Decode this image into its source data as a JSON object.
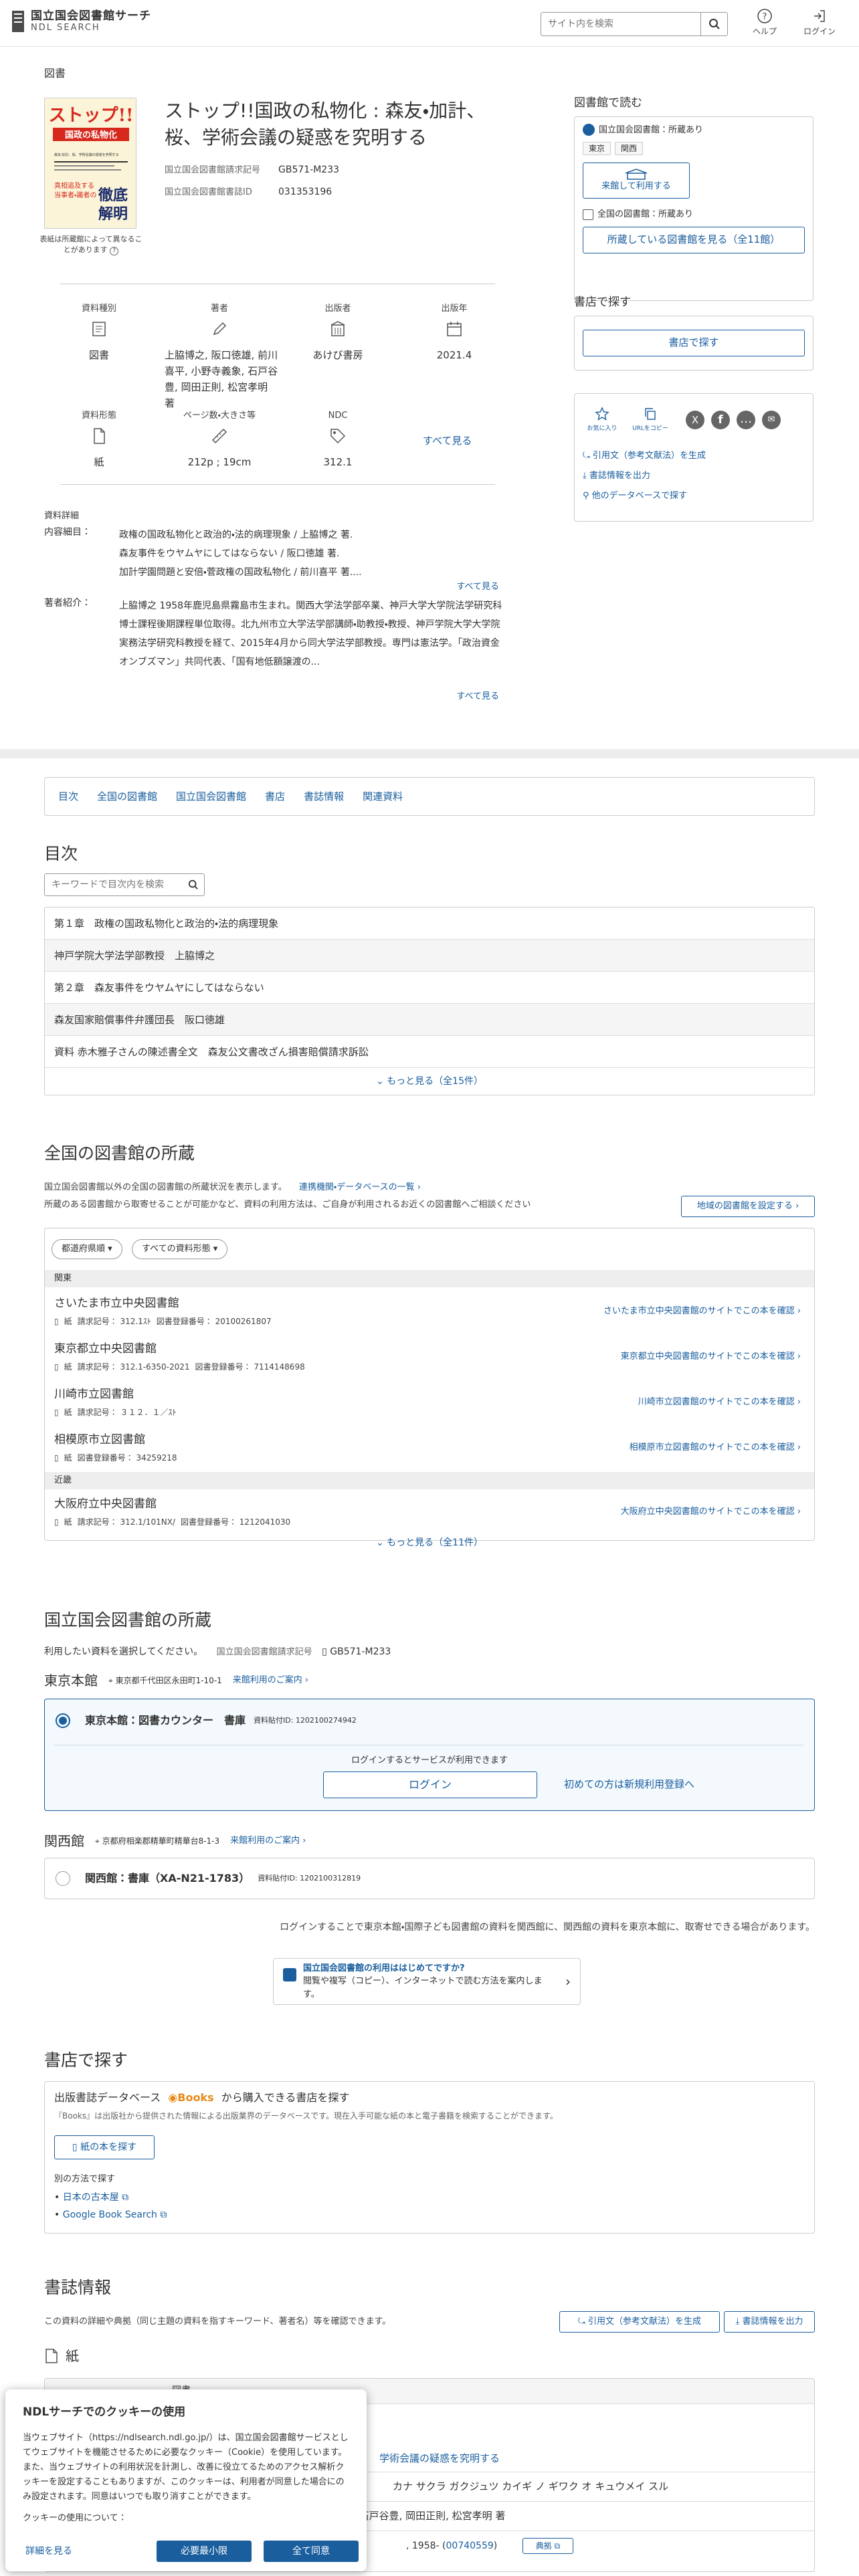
{
  "header": {
    "logo_title": "国立国会図書館サーチ",
    "logo_sub": "NDL SEARCH",
    "search_placeholder": "サイト内を検索",
    "help": "ヘルプ",
    "login": "ログイン"
  },
  "book": {
    "category": "図書",
    "title": "ストップ!!国政の私物化 : 森友・加計、桜、学術会議の疑惑を究明する",
    "cover_note": "表紙は所蔵館によって異なることがあります",
    "call_label": "国立国会図書館請求記号",
    "call_value": "GB571-M233",
    "bib_label": "国立国会図書館書誌ID",
    "bib_value": "031353196",
    "cover_texts": [
      "ストップ!!",
      "国政の私物化",
      "森友・加計、桜、学術会議の疑惑を究明する",
      "真相追及する",
      "当事者・識者の",
      "徹底",
      "解明"
    ],
    "grid": [
      {
        "label": "資料種別",
        "value": "図書",
        "icon": "book-icon"
      },
      {
        "label": "著者",
        "value": "上脇博之, 阪口徳雄, 前川喜平, 小野寺義象, 石戸谷豊, 岡田正則, 松宮孝明 著",
        "icon": "pen-icon"
      },
      {
        "label": "出版者",
        "value": "あけび書房",
        "icon": "building-icon"
      },
      {
        "label": "出版年",
        "value": "2021.4",
        "icon": "calendar-icon"
      },
      {
        "label": "資料形態",
        "value": "紙",
        "icon": "paper-icon"
      },
      {
        "label": "ページ数・大きさ等",
        "value": "212p ; 19cm",
        "icon": "ruler-icon"
      },
      {
        "label": "NDC",
        "value": "312.1",
        "icon": "tag-icon"
      }
    ],
    "see_all": "すべて見る",
    "detail_head": "資料詳細",
    "contents_key": "内容細目：",
    "contents": [
      "政権の国政私物化と政治的・法的病理現象 / 上脇博之 著.",
      "森友事件をウヤムヤにしてはならない / 阪口徳雄 著.",
      "加計学園問題と安倍・菅政権の国政私物化 / 前川喜平 著...."
    ],
    "author_key": "著者紹介：",
    "author_text": "上脇博之 1958年鹿児島県霧島市生まれ。関西大学法学部卒業、神戸大学大学院法学研究科博士課程後期課程単位取得。北九州市立大学法学部講師・助教授・教授、神戸学院大学大学院実務法学研究科教授を経て、2015年4月から同大学法学部教授。専門は憲法学。「政治資金オンブズマン」共同代表、「国有地低額譲渡の...",
    "see_all2": "すべて見る",
    "see_all3": "すべて見る"
  },
  "right": {
    "read_title": "図書館で読む",
    "ndl_holding": "国立国会図書館：所蔵あり",
    "chip1": "東京",
    "chip2": "関西",
    "visit_btn1": "来館して利用する",
    "all_holding": "全国の図書館：所蔵あり",
    "all_btn": "所蔵している図書館を見る（全11館）",
    "shop_title": "書店で探す",
    "shop_btn": "書店で探す",
    "fav": "お気に入り",
    "url": "URLをコピー",
    "cite": "引用文（参考文献法）を生成",
    "export": "書誌情報を出力",
    "other_db": "他のデータベースで探す"
  },
  "tabs": [
    "目次",
    "全国の図書館",
    "国立国会図書館",
    "書店",
    "書誌情報",
    "関連資料"
  ],
  "toc": {
    "title": "目次",
    "placeholder": "キーワードで目次内を検索",
    "rows": [
      "第１章　政権の国政私物化と政治的・法的病理現象",
      "神戸学院大学法学部教授　上脇博之",
      "第２章　森友事件をウヤムヤにしてはならない",
      "森友国家賠償事件弁護団長　阪口徳雄",
      "資料 赤木雅子さんの陳述書全文　森友公文書改ざん損害賠償請求訴訟"
    ],
    "more": "もっと見る（全15件）"
  },
  "libs": {
    "title": "全国の図書館の所蔵",
    "intro1": "国立国会図書館以外の全国の図書館の所蔵状況を表示します。",
    "intro_link": "連携機関・データベースの一覧",
    "intro2": "所蔵のある図書館から取寄せることが可能かなど、資料の利用方法は、ご自身が利用されるお近くの図書館へご相談ください",
    "set_btn": "地域の図書館を設定する",
    "filter1": "都道府県順",
    "filter2": "すべての資料形態",
    "region1": "関東",
    "region2": "近畿",
    "rows": [
      {
        "name": "さいたま市立中央図書館",
        "call": "請求記号： 312.1ｽﾄ",
        "reg": "図書登録番号： 20100261807",
        "go": "さいたま市立中央図書館のサイトでこの本を確認"
      },
      {
        "name": "東京都立中央図書館",
        "call": "請求記号： 312.1-6350-2021",
        "reg": "図書登録番号： 7114148698",
        "go": "東京都立中央図書館のサイトでこの本を確認"
      },
      {
        "name": "川崎市立図書館",
        "call": "請求記号： ３１２．１／ｽﾄ",
        "reg": "",
        "go": "川崎市立図書館のサイトでこの本を確認"
      },
      {
        "name": "相模原市立図書館",
        "call": "",
        "reg": "図書登録番号： 34259218",
        "go": "相模原市立図書館のサイトでこの本を確認"
      },
      {
        "name": "大阪府立中央図書館",
        "call": "請求記号： 312.1/101NX/",
        "reg": "図書登録番号： 1212041030",
        "go": "大阪府立中央図書館のサイトでこの本を確認"
      }
    ],
    "paper": "紙",
    "more": "もっと見る（全11件）"
  },
  "ndl": {
    "title": "国立国会図書館の所蔵",
    "choose": "利用したい資料を選択してください。",
    "call_label": "国立国会図書館請求記号",
    "call_value": "GB571-M233",
    "tokyo": "東京本館",
    "tokyo_addr": "東京都千代田区永田町1-10-1",
    "visit_info": "来館利用のご案内",
    "tokyo_item": "東京本館：図書カウンター　書庫",
    "tokyo_id": "資料貼付ID: 1202100274942",
    "login_note": "ログインするとサービスが利用できます",
    "login_btn": "ログイン",
    "register": "初めての方は新規利用登録へ",
    "kansai": "関西館",
    "kansai_addr": "京都府相楽郡精華町精華台8-1-3",
    "kansai_item": "関西館：書庫（XA-N21-1783）",
    "kansai_id": "資料貼付ID: 1202100312819",
    "transfer_note": "ログインすることで東京本館・国際子ども図書館の資料を関西館に、関西館の資料を東京本館に、取寄せできる場合があります。",
    "first_q": "国立国会図書館の利用ははじめてですか?",
    "first_a": "閲覧や複写（コピー）、インターネットで読む方法を案内します。"
  },
  "shop": {
    "title": "書店で探す",
    "head": "出版書誌データベース",
    "books_brand": "Books",
    "head2": "から購入できる書店を探す",
    "note": "『Books』は出版社から提供された情報による出版業界のデータベースです。現在入手可能な紙の本と電子書籍を検索することができます。",
    "paper_btn": "紙の本を探す",
    "other": "別の方法で探す",
    "links": [
      "日本の古本屋",
      "Google Book Search"
    ]
  },
  "biblio": {
    "title": "書誌情報",
    "intro": "この資料の詳細や典拠（同じ主題の資料を指すキーワード、著者名）等を確認できます。",
    "cite": "引用文（参考文献法）を生成",
    "export": "書誌情報を出力",
    "paper": "紙",
    "row1": "学術会議の疑惑を究明する",
    "row2": "カナ サクラ ガクジュツ カイギ ノ ギワク オ キュウメイ スル",
    "row3": ", 石戸谷豊, 岡田正則, 松宮孝明 著",
    "row4a": ", 1958- (",
    "row4b": "00740559",
    "row4c": ")",
    "authority": "典拠",
    "row0": "図書"
  },
  "cookie": {
    "title": "NDLサーチでのクッキーの使用",
    "body": "当ウェブサイト（https://ndlsearch.ndl.go.jp/）は、国立国会図書館サービスとしてウェブサイトを機能させるために必要なクッキー（Cookie）を使用しています。また、当ウェブサイトの利用状況を計測し、改善に役立てるためのアクセス解析クッキーを設定することもありますが、このクッキーは、利用者が同意した場合にのみ設定されます。同意はいつでも取り消すことができます。",
    "usage": "クッキーの使用について：",
    "detail": "詳細を見る",
    "min": "必要最小限",
    "all": "全て同意"
  }
}
